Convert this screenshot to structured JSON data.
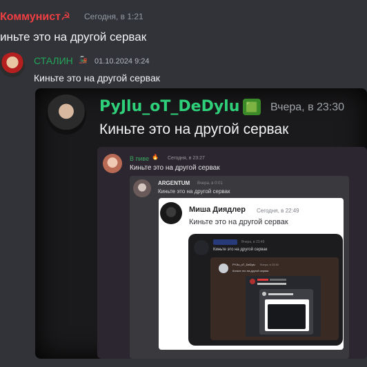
{
  "top": {
    "author": "Коммунист☭",
    "time": "Сегодня, в 1:21",
    "text": "иньте это на другой сервак"
  },
  "level1": {
    "author": "СТАЛИН",
    "badge": "🚂",
    "date": "01.10.2024 9:24",
    "text": "Киньте это на другой сервак"
  },
  "level2": {
    "author": "PyJlu_oT_DeDylu",
    "badge": "🟩",
    "time": "Вчера, в 23:30",
    "text": "Киньте это на другой сервак"
  },
  "level3": {
    "author": "В пиве",
    "badge": "🔥",
    "date": "Сегодня, в 23:27",
    "text": "Киньте это на другой сервак"
  },
  "level4": {
    "author": "ARGENTUM",
    "date": "Вчера, в 0:01",
    "text": "Киньте это на другой сервак"
  },
  "level5": {
    "author": "Миша Диядлер",
    "time": "Сегодня, в 22:49",
    "text": "Киньте это на другой сервак"
  },
  "level6": {
    "date": "Вчера, в 23:49",
    "text": "Киньте это на другой сервак"
  },
  "level7": {
    "author": "PYJlu_oT_DeDylu",
    "date": "Вчера, в 23:30",
    "text": "Киньте это на другой сервак"
  },
  "colors": {
    "background": "#313338",
    "red_name": "#f23f43",
    "green_name": "#23a55a"
  }
}
